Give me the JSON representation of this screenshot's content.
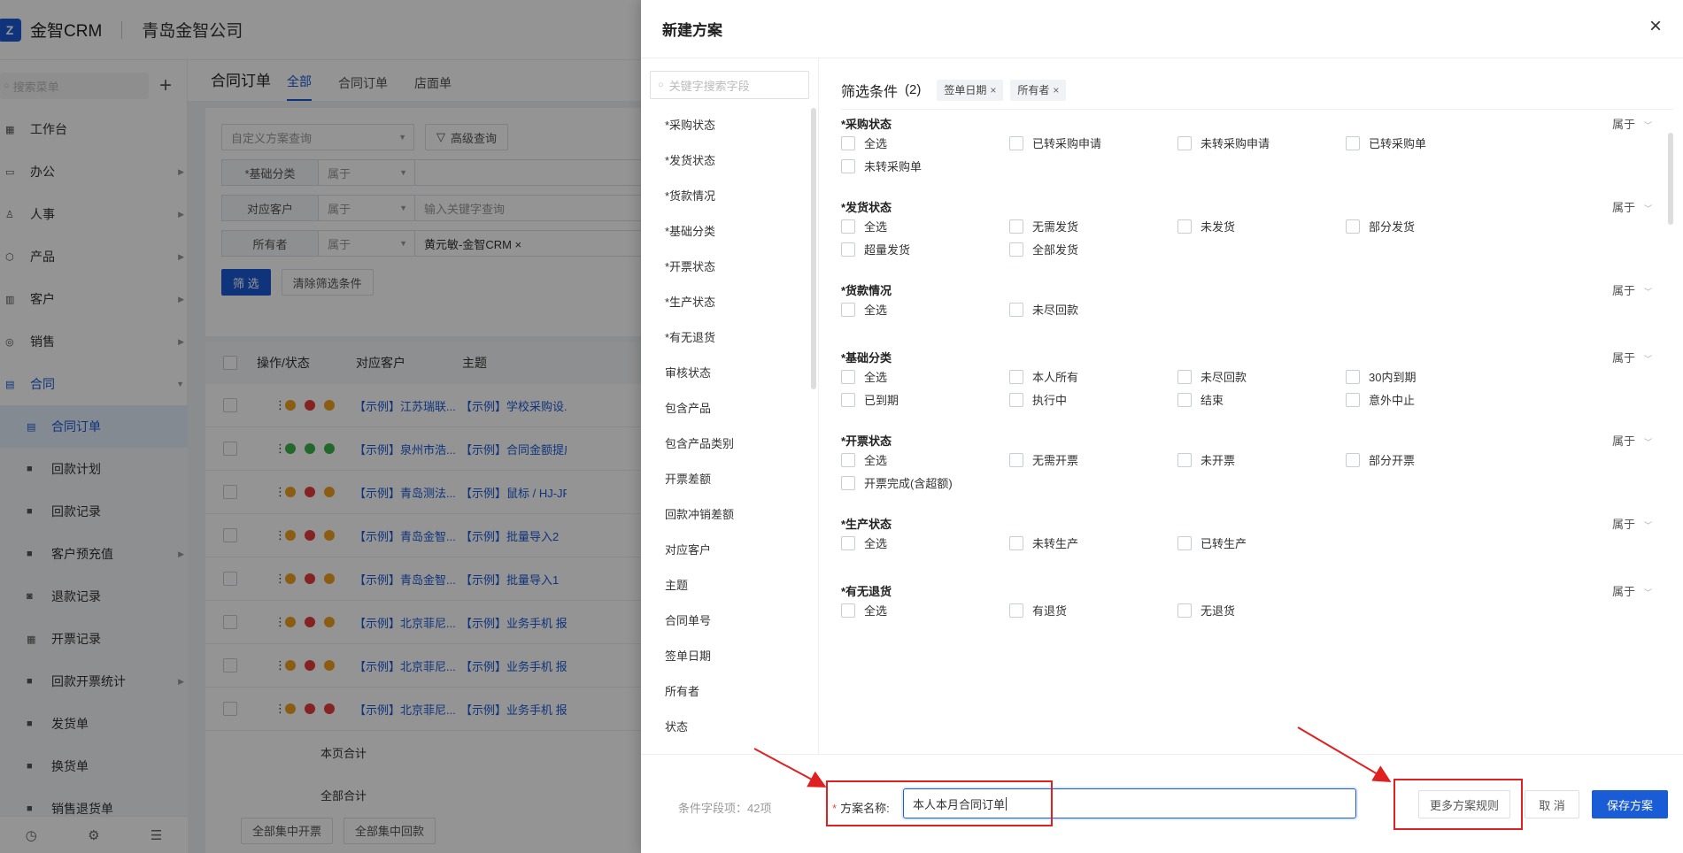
{
  "topbar": {
    "logo_text": "Z",
    "brand": "金智CRM",
    "company": "青岛金智公司"
  },
  "sidebar": {
    "search_placeholder": "搜索菜单",
    "items": [
      {
        "label": "工作台",
        "icon": "dashboard-icon",
        "arrow": false
      },
      {
        "label": "办公",
        "icon": "office-icon",
        "arrow": true
      },
      {
        "label": "人事",
        "icon": "people-icon",
        "arrow": true
      },
      {
        "label": "产品",
        "icon": "box-icon",
        "arrow": true
      },
      {
        "label": "客户",
        "icon": "chart-icon",
        "arrow": true
      },
      {
        "label": "销售",
        "icon": "sales-icon",
        "arrow": true
      },
      {
        "label": "合同",
        "icon": "contract-icon",
        "arrow": true
      }
    ],
    "sub_items": [
      "合同订单",
      "回款计划",
      "回款记录",
      "客户预充值",
      "退款记录",
      "开票记录",
      "回款开票统计",
      "发货单",
      "换货单",
      "销售退货单"
    ],
    "active_sub": "合同订单"
  },
  "main": {
    "title": "合同订单",
    "tabs": [
      "全部",
      "合同订单",
      "店面单"
    ],
    "active_tab": "全部",
    "scheme_placeholder": "自定义方案查询",
    "advanced_btn": "高级查询",
    "filters": [
      {
        "label": "*基础分类",
        "op": "属于",
        "value": ""
      },
      {
        "label": "对应客户",
        "op": "属于",
        "value": "输入关键字查询"
      },
      {
        "label": "所有者",
        "op": "属于",
        "value": "黄元敏-金智CRM ×"
      }
    ],
    "filter_btn": "筛 选",
    "clear_btn": "清除筛选条件",
    "table_headers": [
      "操作/状态",
      "对应客户",
      "主题"
    ],
    "rows": [
      {
        "customer": "【示例】江苏瑞联...",
        "subject": "【示例】学校采购设..."
      },
      {
        "customer": "【示例】泉州市浩...",
        "subject": "【示例】合同金额提成"
      },
      {
        "customer": "【示例】青岛测法...",
        "subject": "【示例】鼠标 / HJ-JP..."
      },
      {
        "customer": "【示例】青岛金智...",
        "subject": "【示例】批量导入2"
      },
      {
        "customer": "【示例】青岛金智...",
        "subject": "【示例】批量导入1"
      },
      {
        "customer": "【示例】北京菲尼...",
        "subject": "【示例】业务手机 报..."
      },
      {
        "customer": "【示例】北京菲尼...",
        "subject": "【示例】业务手机 报..."
      },
      {
        "customer": "【示例】北京菲尼...",
        "subject": "【示例】业务手机 报..."
      }
    ],
    "page_total": "本页合计",
    "all_total": "全部合计",
    "bulk_invoice": "全部集中开票",
    "bulk_payment": "全部集中回款"
  },
  "drawer": {
    "title": "新建方案",
    "close": "×",
    "field_search_placeholder": "关键字搜索字段",
    "fields": [
      "*采购状态",
      "*发货状态",
      "*货款情况",
      "*基础分类",
      "*开票状态",
      "*生产状态",
      "*有无退货",
      "审核状态",
      "包含产品",
      "包含产品类别",
      "开票差额",
      "回款冲销差额",
      "对应客户",
      "主题",
      "合同单号",
      "签单日期",
      "所有者",
      "状态"
    ],
    "cond_title": "筛选条件",
    "cond_count": "(2)",
    "tags": [
      "签单日期",
      "所有者"
    ],
    "groups": [
      {
        "title": "*采购状态",
        "op": "属于",
        "options": [
          "全选",
          "已转采购申请",
          "未转采购申请",
          "已转采购单",
          "未转采购单"
        ]
      },
      {
        "title": "*发货状态",
        "op": "属于",
        "options": [
          "全选",
          "无需发货",
          "未发货",
          "部分发货",
          "超量发货",
          "全部发货"
        ]
      },
      {
        "title": "*货款情况",
        "op": "属于",
        "options": [
          "全选",
          "未尽回款"
        ]
      },
      {
        "title": "*基础分类",
        "op": "属于",
        "options": [
          "全选",
          "本人所有",
          "未尽回款",
          "30内到期",
          "已到期",
          "执行中",
          "结束",
          "意外中止"
        ]
      },
      {
        "title": "*开票状态",
        "op": "属于",
        "options": [
          "全选",
          "无需开票",
          "未开票",
          "部分开票",
          "开票完成(含超额)"
        ]
      },
      {
        "title": "*生产状态",
        "op": "属于",
        "options": [
          "全选",
          "未转生产",
          "已转生产"
        ]
      },
      {
        "title": "*有无退货",
        "op": "属于",
        "options": [
          "全选",
          "有退货",
          "无退货"
        ]
      }
    ],
    "footer": {
      "field_count": "条件字段项：42项",
      "name_label": "方案名称:",
      "name_required": "*",
      "name_value": "本人本月合同订单",
      "more_rules": "更多方案规则",
      "cancel": "取 消",
      "save": "保存方案"
    }
  },
  "colors": {
    "accent": "#1a5bd6",
    "annotation": "#e02020"
  }
}
